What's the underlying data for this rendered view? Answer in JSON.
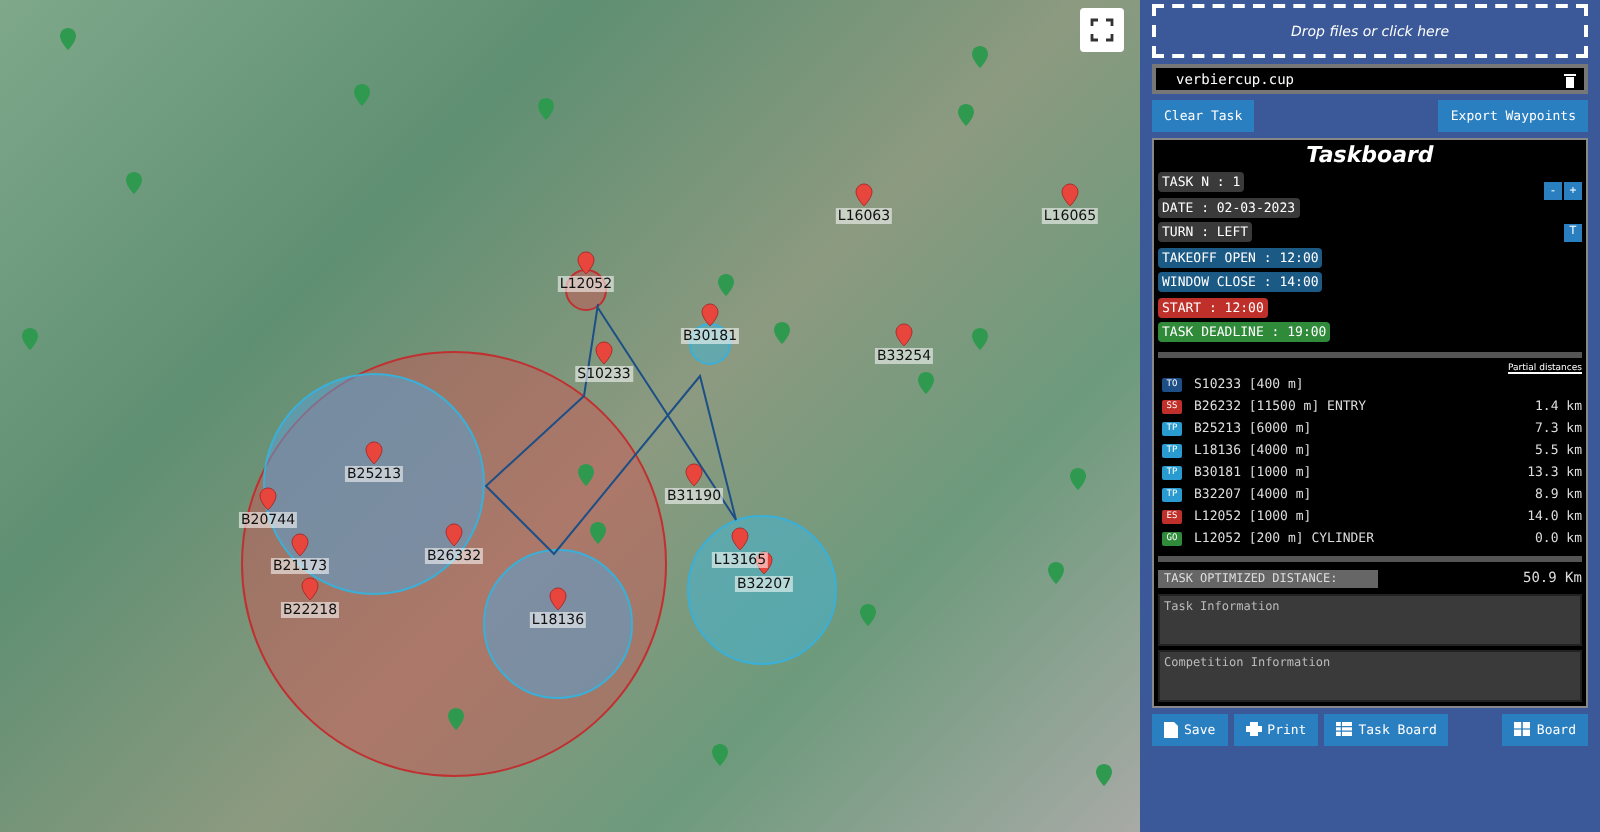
{
  "map": {
    "waypoints": [
      {
        "label": "L12052"
      },
      {
        "label": "S10233"
      },
      {
        "label": "B30181"
      },
      {
        "label": "B25213"
      },
      {
        "label": "B26332"
      },
      {
        "label": "L18136"
      },
      {
        "label": "B31190"
      },
      {
        "label": "L13165"
      },
      {
        "label": "B32207"
      },
      {
        "label": "L16063"
      },
      {
        "label": "L16065"
      },
      {
        "label": "B33254"
      },
      {
        "label": "B20744"
      },
      {
        "label": "B21173"
      },
      {
        "label": "B22218"
      }
    ]
  },
  "upload": {
    "prompt": "Drop files or click here",
    "file_name": "verbiercup.cup"
  },
  "actions": [
    "Clear Task",
    "Export Waypoints"
  ],
  "taskboard": {
    "title": "Taskboard",
    "fields": [
      {
        "kind": "plain",
        "text": "TASK N : 1"
      },
      {
        "kind": "plain",
        "text": "DATE : 02-03-2023"
      },
      {
        "kind": "plain",
        "text": "TURN : LEFT"
      },
      {
        "kind": "time",
        "text": "TAKEOFF OPEN : 12:00"
      },
      {
        "kind": "time",
        "text": "WINDOW CLOSE : 14:00"
      },
      {
        "kind": "start",
        "text": "START : 12:00"
      },
      {
        "kind": "deadline",
        "text": "TASK DEADLINE : 19:00"
      }
    ],
    "task_buttons": [
      "-",
      "+"
    ],
    "turn_button": "T",
    "partial_header": "Partial distances",
    "turnpoints": [
      {
        "type": "TO",
        "name": "S10233 [400 m]"
      },
      {
        "type": "SS",
        "name": "B26232 [11500 m] ENTRY",
        "distance": "1.4 km"
      },
      {
        "type": "TP",
        "name": "B25213 [6000 m]",
        "distance": "7.3 km"
      },
      {
        "type": "TP",
        "name": "L18136 [4000 m]",
        "distance": "5.5 km"
      },
      {
        "type": "TP",
        "name": "B30181 [1000 m]",
        "distance": "13.3 km"
      },
      {
        "type": "TP",
        "name": "B32207 [4000 m]",
        "distance": "8.9 km"
      },
      {
        "type": "ES",
        "name": "L12052 [1000 m]",
        "distance": "14.0 km"
      },
      {
        "type": "GO",
        "name": "L12052 [200 m] CYLINDER",
        "distance": "0.0 km"
      }
    ],
    "total_label": "TASK OPTIMIZED DISTANCE:",
    "total_value": "50.9 Km",
    "task_info": {
      "placeholder": "Task Information"
    },
    "competition_info": {
      "placeholder": "Competition Information"
    }
  },
  "footer_buttons": [
    {
      "kind": "save",
      "label": "Save"
    },
    {
      "kind": "print",
      "label": "Print"
    },
    {
      "kind": "table",
      "label": "Task Board"
    },
    {
      "kind": "grid",
      "label": "Board"
    }
  ]
}
